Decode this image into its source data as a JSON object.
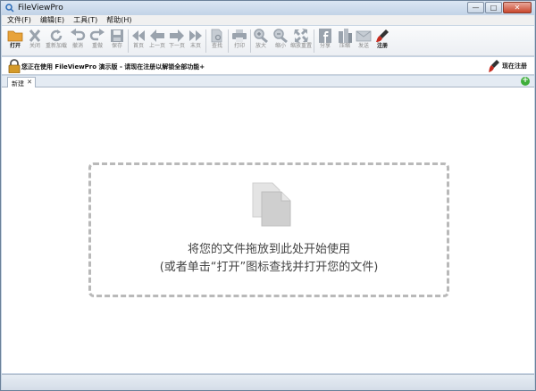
{
  "window": {
    "title": "FileViewPro"
  },
  "menu": [
    "文件(F)",
    "编辑(E)",
    "工具(T)",
    "帮助(H)"
  ],
  "toolbar": {
    "open": "打开",
    "close": "关闭",
    "reload": "重新加载",
    "undo": "撤消",
    "redo": "重做",
    "save": "保存",
    "first": "首页",
    "prev": "上一页",
    "next": "下一页",
    "last": "末页",
    "find": "查找",
    "print": "打印",
    "zoom_in": "放大",
    "zoom_out": "缩小",
    "zoom_reset": "缩放重置",
    "share": "分享",
    "compress": "压缩",
    "send": "发送",
    "register": "注册"
  },
  "notice": {
    "text": "您正在使用 FileViewPro 演示版 - 请现在注册以解锁全部功能+",
    "register_now": "现在注册"
  },
  "tabs": [
    {
      "label": "新建",
      "close": "✕"
    }
  ],
  "add_tab": "+",
  "dropzone": {
    "line1": "将您的文件拖放到此处开始使用",
    "line2": "(或者单击“打开”图标查找并打开您的文件)"
  },
  "colors": {
    "accent": "#3fae3a",
    "folder": "#e8a33a",
    "icon_disabled": "#9aa3ad"
  }
}
